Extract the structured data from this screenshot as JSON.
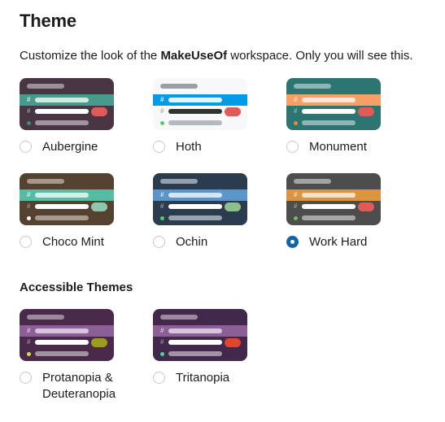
{
  "header": {
    "title": "Theme",
    "description_prefix": "Customize the look of the ",
    "description_workspace": "MakeUseOf",
    "description_suffix": " workspace. Only you will see this."
  },
  "sections": {
    "accessible_title": "Accessible Themes"
  },
  "selected_theme": "Work Hard",
  "themes": [
    {
      "name": "Aubergine",
      "selected": false,
      "colors": {
        "sidebar": "#4a3545",
        "top_bar": "#9b8f98",
        "active_row": "#479b8c",
        "active_text": "#cfe9e3",
        "hash": "#9e8f99",
        "text_bright": "#ffffff",
        "text_dim": "#a294a0",
        "presence": "#3a8a7d",
        "badge": "#e05a5a"
      }
    },
    {
      "name": "Hoth",
      "selected": false,
      "colors": {
        "sidebar": "#f8f8fa",
        "top_bar": "#9aa0a6",
        "active_row": "#039be5",
        "active_text": "#e8f4fb",
        "hash": "#a8adb3",
        "text_bright": "#2f3336",
        "text_dim": "#b4b9bd",
        "presence": "#4bd163",
        "badge": "#e05a5a"
      }
    },
    {
      "name": "Monument",
      "selected": false,
      "colors": {
        "sidebar": "#2d7572",
        "top_bar": "#8fb6b4",
        "active_row": "#f79f66",
        "active_text": "#fde6d5",
        "hash": "#87b2b0",
        "text_bright": "#ffffff",
        "text_dim": "#8fb6b4",
        "presence": "#e8883f",
        "badge": "#e05a5a"
      }
    },
    {
      "name": "Choco Mint",
      "selected": false,
      "colors": {
        "sidebar": "#54412f",
        "top_bar": "#a59786",
        "active_row": "#56bda4",
        "active_text": "#d6f0e8",
        "hash": "#a09183",
        "text_bright": "#ffffff",
        "text_dim": "#a79a8b",
        "presence": "#ffffff",
        "badge": "#8ec7ad"
      }
    },
    {
      "name": "Ochin",
      "selected": false,
      "colors": {
        "sidebar": "#2b3c4e",
        "top_bar": "#93a0ac",
        "active_row": "#5b95c9",
        "active_text": "#d7e5f2",
        "hash": "#8e9aa6",
        "text_bright": "#ffffff",
        "text_dim": "#96a2ad",
        "presence": "#4bd163",
        "badge": "#8fbf8a"
      }
    },
    {
      "name": "Work Hard",
      "selected": true,
      "colors": {
        "sidebar": "#4d4d4d",
        "top_bar": "#a3a3a3",
        "active_row": "#dd9440",
        "active_text": "#f6e2cb",
        "hash": "#9b9b9b",
        "text_bright": "#ffffff",
        "text_dim": "#a6a6a6",
        "presence": "#66c05b",
        "badge": "#e05a5a"
      }
    }
  ],
  "accessible_themes": [
    {
      "name": "Protanopia & Deuteranopia",
      "selected": false,
      "colors": {
        "sidebar": "#4a2a4a",
        "top_bar": "#9c8a9c",
        "active_row": "#8c5f96",
        "active_text": "#d9c4dd",
        "hash": "#9c8a9c",
        "text_bright": "#ffffff",
        "text_dim": "#a192a1",
        "presence": "#d8dc3f",
        "badge": "#9e9c1e"
      }
    },
    {
      "name": "Tritanopia",
      "selected": false,
      "colors": {
        "sidebar": "#42284a",
        "top_bar": "#9c8aa0",
        "active_row": "#8c5f96",
        "active_text": "#d9c4dd",
        "hash": "#9c8aa0",
        "text_bright": "#ffffff",
        "text_dim": "#a192a6",
        "presence": "#3ed99a",
        "badge": "#e2452e"
      }
    }
  ],
  "accent_color": "#1264a3"
}
